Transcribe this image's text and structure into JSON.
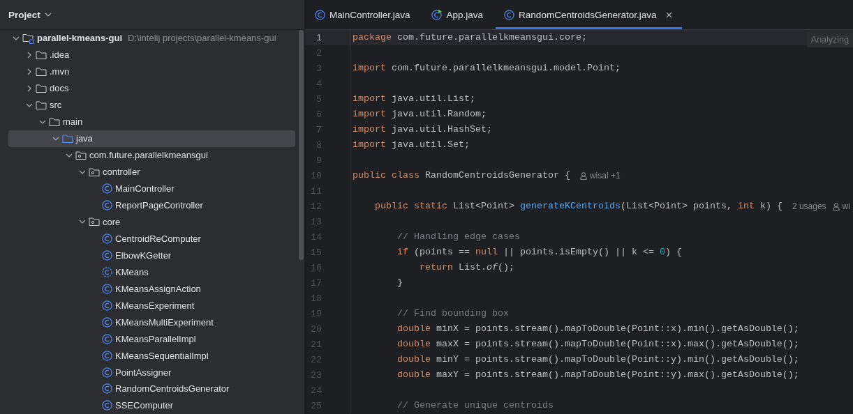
{
  "project_panel": {
    "title": "Project",
    "tree": [
      {
        "label": "parallel-kmeans-gui",
        "path": "D:\\intelij projects\\parallel-kmeans-gui",
        "kind": "module",
        "expanded": true,
        "selected": false,
        "children": [
          {
            "label": ".idea",
            "kind": "folder",
            "expanded": false,
            "selected": false
          },
          {
            "label": ".mvn",
            "kind": "folder",
            "expanded": false,
            "selected": false
          },
          {
            "label": "docs",
            "kind": "folder",
            "expanded": false,
            "selected": false
          },
          {
            "label": "src",
            "kind": "folder",
            "expanded": true,
            "selected": false,
            "children": [
              {
                "label": "main",
                "kind": "folder",
                "expanded": true,
                "selected": false,
                "children": [
                  {
                    "label": "java",
                    "kind": "source-folder",
                    "expanded": true,
                    "selected": true,
                    "children": [
                      {
                        "label": "com.future.parallelkmeansgui",
                        "kind": "package",
                        "expanded": true,
                        "selected": false,
                        "children": [
                          {
                            "label": "controller",
                            "kind": "package",
                            "expanded": true,
                            "selected": false,
                            "children": [
                              {
                                "label": "MainController",
                                "kind": "class",
                                "selected": false
                              },
                              {
                                "label": "ReportPageController",
                                "kind": "class",
                                "selected": false
                              }
                            ]
                          },
                          {
                            "label": "core",
                            "kind": "package",
                            "expanded": true,
                            "selected": false,
                            "children": [
                              {
                                "label": "CentroidReComputer",
                                "kind": "class",
                                "selected": false
                              },
                              {
                                "label": "ElbowKGetter",
                                "kind": "class",
                                "selected": false
                              },
                              {
                                "label": "KMeans",
                                "kind": "abstract-class",
                                "selected": false
                              },
                              {
                                "label": "KMeansAssignAction",
                                "kind": "class",
                                "selected": false
                              },
                              {
                                "label": "KMeansExperiment",
                                "kind": "class",
                                "selected": false
                              },
                              {
                                "label": "KMeansMultiExperiment",
                                "kind": "class",
                                "selected": false
                              },
                              {
                                "label": "KMeansParallelImpl",
                                "kind": "class",
                                "selected": false
                              },
                              {
                                "label": "KMeansSequentialImpl",
                                "kind": "class",
                                "selected": false
                              },
                              {
                                "label": "PointAssigner",
                                "kind": "class",
                                "selected": false
                              },
                              {
                                "label": "RandomCentroidsGenerator",
                                "kind": "class",
                                "selected": false
                              },
                              {
                                "label": "SSEComputer",
                                "kind": "class",
                                "selected": false
                              }
                            ]
                          }
                        ]
                      }
                    ]
                  }
                ]
              }
            ]
          }
        ]
      }
    ]
  },
  "editor": {
    "tabs": [
      {
        "label": "MainController.java",
        "kind": "class",
        "selected": false
      },
      {
        "label": "App.java",
        "kind": "app",
        "selected": false
      },
      {
        "label": "RandomCentroidsGenerator.java",
        "kind": "class",
        "selected": true
      }
    ],
    "status": "Analyzing",
    "lines": [
      {
        "number": "1",
        "current": true,
        "tokens": [
          {
            "kind": "keyword",
            "text": "package"
          },
          {
            "kind": "plain",
            "text": " com.future.parallelkmeansgui.core;"
          }
        ]
      },
      {
        "number": "2",
        "current": false
      },
      {
        "number": "3",
        "current": false,
        "tokens": [
          {
            "kind": "keyword",
            "text": "import"
          },
          {
            "kind": "plain",
            "text": " com.future.parallelkmeansgui.model.Point;"
          }
        ]
      },
      {
        "number": "4",
        "current": false
      },
      {
        "number": "5",
        "current": false,
        "tokens": [
          {
            "kind": "keyword",
            "text": "import"
          },
          {
            "kind": "plain",
            "text": " java.util.List;"
          }
        ]
      },
      {
        "number": "6",
        "current": false,
        "tokens": [
          {
            "kind": "keyword",
            "text": "import"
          },
          {
            "kind": "plain",
            "text": " java.util.Random;"
          }
        ]
      },
      {
        "number": "7",
        "current": false,
        "tokens": [
          {
            "kind": "keyword",
            "text": "import"
          },
          {
            "kind": "plain",
            "text": " java.util.HashSet;"
          }
        ]
      },
      {
        "number": "8",
        "current": false,
        "tokens": [
          {
            "kind": "keyword",
            "text": "import"
          },
          {
            "kind": "plain",
            "text": " java.util.Set;"
          }
        ]
      },
      {
        "number": "9",
        "current": false
      },
      {
        "number": "10",
        "current": false,
        "tokens": [
          {
            "kind": "keyword",
            "text": "public class"
          },
          {
            "kind": "plain",
            "text": " RandomCentroidsGenerator {"
          }
        ],
        "hints": [
          {
            "kind": "author",
            "text": "wisal +1"
          }
        ]
      },
      {
        "number": "11",
        "current": false
      },
      {
        "number": "12",
        "current": false,
        "tokens": [
          {
            "kind": "keyword",
            "text": "    public static"
          },
          {
            "kind": "plain",
            "text": " List<Point> "
          },
          {
            "kind": "method",
            "text": "generateKCentroids"
          },
          {
            "kind": "plain",
            "text": "(List<Point> points, "
          },
          {
            "kind": "keyword",
            "text": "int"
          },
          {
            "kind": "plain",
            "text": " k) {"
          }
        ],
        "hints": [
          {
            "kind": "usages",
            "text": "2 usages"
          },
          {
            "kind": "author",
            "text": "wi"
          }
        ]
      },
      {
        "number": "13",
        "current": false
      },
      {
        "number": "14",
        "current": false,
        "tokens": [
          {
            "kind": "comment",
            "text": "        // Handling edge cases"
          }
        ]
      },
      {
        "number": "15",
        "current": false,
        "tokens": [
          {
            "kind": "keyword",
            "text": "        if"
          },
          {
            "kind": "plain",
            "text": " (points == "
          },
          {
            "kind": "keyword",
            "text": "null"
          },
          {
            "kind": "plain",
            "text": " || points.isEmpty() || k <= "
          },
          {
            "kind": "number",
            "text": "0"
          },
          {
            "kind": "plain",
            "text": ") {"
          }
        ]
      },
      {
        "number": "16",
        "current": false,
        "tokens": [
          {
            "kind": "keyword",
            "text": "            return"
          },
          {
            "kind": "plain",
            "text": " List."
          },
          {
            "kind": "static-call",
            "text": "of"
          },
          {
            "kind": "plain",
            "text": "();"
          }
        ]
      },
      {
        "number": "17",
        "current": false,
        "tokens": [
          {
            "kind": "plain",
            "text": "        }"
          }
        ]
      },
      {
        "number": "18",
        "current": false
      },
      {
        "number": "19",
        "current": false,
        "tokens": [
          {
            "kind": "comment",
            "text": "        // Find bounding box"
          }
        ]
      },
      {
        "number": "20",
        "current": false,
        "tokens": [
          {
            "kind": "keyword",
            "text": "        double"
          },
          {
            "kind": "plain",
            "text": " minX = points.stream().mapToDouble(Point::x).min().getAsDouble();"
          }
        ]
      },
      {
        "number": "21",
        "current": false,
        "tokens": [
          {
            "kind": "keyword",
            "text": "        double"
          },
          {
            "kind": "plain",
            "text": " maxX = points.stream().mapToDouble(Point::x).max().getAsDouble();"
          }
        ]
      },
      {
        "number": "22",
        "current": false,
        "tokens": [
          {
            "kind": "keyword",
            "text": "        double"
          },
          {
            "kind": "plain",
            "text": " minY = points.stream().mapToDouble(Point::y).min().getAsDouble();"
          }
        ]
      },
      {
        "number": "23",
        "current": false,
        "tokens": [
          {
            "kind": "keyword",
            "text": "        double"
          },
          {
            "kind": "plain",
            "text": " maxY = points.stream().mapToDouble(Point::y).max().getAsDouble();"
          }
        ]
      },
      {
        "number": "24",
        "current": false
      },
      {
        "number": "25",
        "current": false,
        "tokens": [
          {
            "kind": "comment",
            "text": "        // Generate unique centroids"
          }
        ]
      }
    ]
  }
}
